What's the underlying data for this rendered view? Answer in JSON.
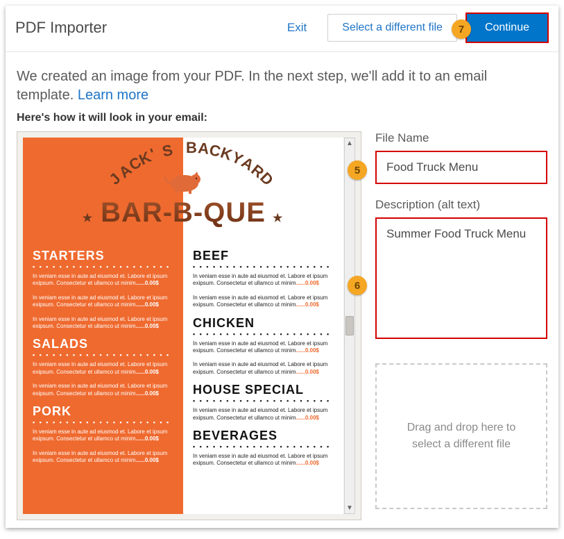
{
  "header": {
    "title": "PDF Importer",
    "exit": "Exit",
    "select_different": "Select a different file",
    "continue": "Continue"
  },
  "badges": {
    "b5": "5",
    "b6": "6",
    "b7": "7"
  },
  "body": {
    "intro_a": "We created an image from your PDF. In the next step, we'll add it to an email template. ",
    "learn": "Learn more",
    "sub": "Here's how it will look in your email:"
  },
  "form": {
    "file_label": "File Name",
    "file_value": "Food Truck Menu",
    "desc_label": "Description (alt text)",
    "desc_value": "Summer Food Truck Menu",
    "drop": "Drag and drop here to select a different file"
  },
  "preview": {
    "brand_arc": "JACK'S BACKYARD",
    "brand_main": "BAR-B-QUE",
    "star": "★",
    "dot_row": "• • • • • • • • • • • • • • • • • • • • • • • • • • •",
    "lorem1": "In veniam esse in aute ad eiusmod et. Labore et ipsum exipsum. Consectetur et ullamco ut minim",
    "price": "......0.00$",
    "left_sections": [
      "STARTERS",
      "SALADS",
      "PORK"
    ],
    "right_sections": [
      "BEEF",
      "CHICKEN",
      "HOUSE SPECIAL",
      "BEVERAGES"
    ]
  }
}
